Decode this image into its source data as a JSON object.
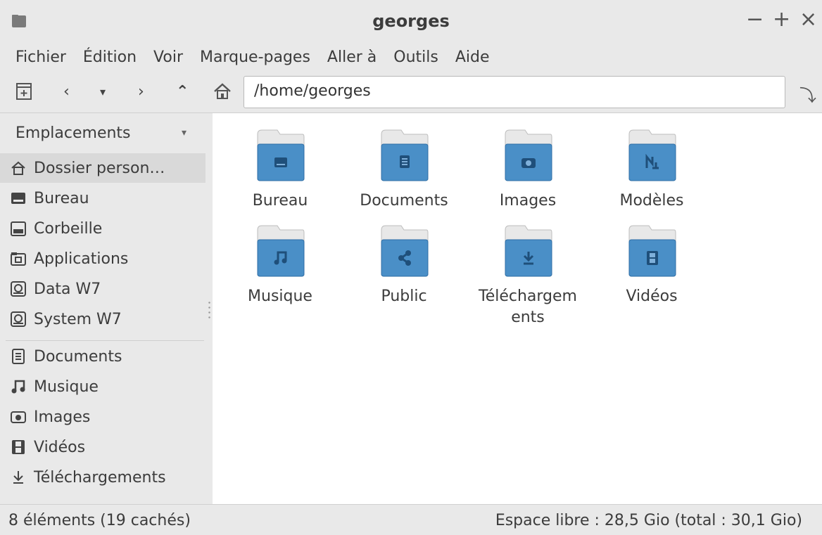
{
  "window": {
    "title": "georges",
    "minimize": "−",
    "maximize": "+",
    "close": "×"
  },
  "menubar": [
    "Fichier",
    "Édition",
    "Voir",
    "Marque-pages",
    "Aller à",
    "Outils",
    "Aide"
  ],
  "toolbar": {
    "back": "‹",
    "history": "▾",
    "forward": "›",
    "up": "⌃",
    "path": "/home/georges",
    "go": "⤵"
  },
  "sidebar": {
    "header": "Emplacements",
    "header_caret": "▾",
    "places": [
      {
        "label": "Dossier person…",
        "icon": "home-icon"
      },
      {
        "label": "Bureau",
        "icon": "desktop-icon"
      },
      {
        "label": "Corbeille",
        "icon": "trash-icon"
      },
      {
        "label": "Applications",
        "icon": "applications-icon"
      },
      {
        "label": "Data W7",
        "icon": "drive-icon"
      },
      {
        "label": "System W7",
        "icon": "drive-icon"
      }
    ],
    "bookmarks": [
      {
        "label": "Documents",
        "icon": "document-icon"
      },
      {
        "label": "Musique",
        "icon": "music-icon"
      },
      {
        "label": "Images",
        "icon": "camera-icon"
      },
      {
        "label": "Vidéos",
        "icon": "film-icon"
      },
      {
        "label": "Téléchargements",
        "icon": "download-icon"
      }
    ]
  },
  "files": [
    {
      "name": "Bureau",
      "icon": "desktop-icon"
    },
    {
      "name": "Documents",
      "icon": "document-icon"
    },
    {
      "name": "Images",
      "icon": "camera-icon"
    },
    {
      "name": "Modèles",
      "icon": "templates-icon"
    },
    {
      "name": "Musique",
      "icon": "music-icon"
    },
    {
      "name": "Public",
      "icon": "share-icon"
    },
    {
      "name_line1": "Téléchargem",
      "name_line2": "ents",
      "icon": "download-icon"
    },
    {
      "name": "Vidéos",
      "icon": "film-icon"
    }
  ],
  "status": {
    "left": "8 éléments (19 cachés)",
    "right": "Espace libre : 28,5 Gio (total : 30,1 Gio)"
  },
  "colors": {
    "folder_blue": "#4a8fc7",
    "folder_dark": "#2f6ea6",
    "chrome": "#e9e9e9"
  }
}
